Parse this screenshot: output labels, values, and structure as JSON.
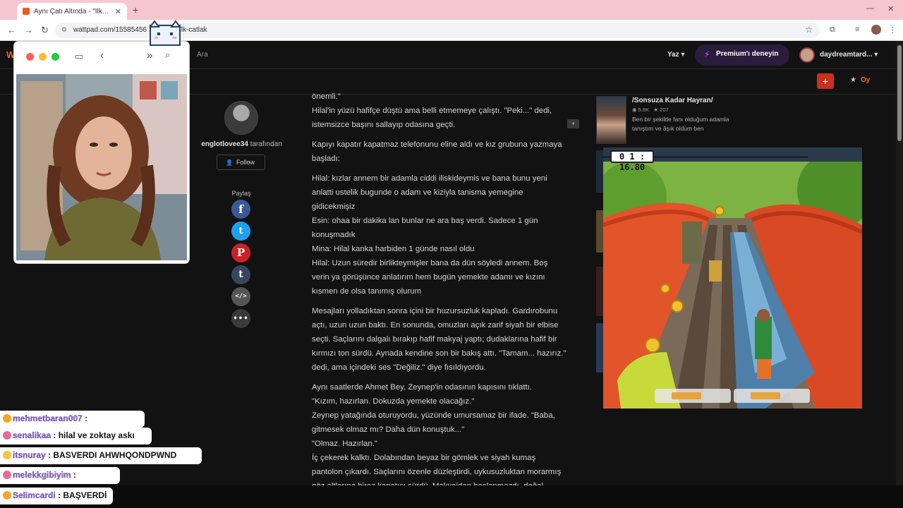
{
  "browser": {
    "tab_title": "Aynı Çatı Altında - \"İlk çatlak\"",
    "url": "wattpad.com/15585456 ... altinda-ilk-catlak"
  },
  "wattpad": {
    "search_label": "Ara",
    "write_label": "Yaz ▾",
    "premium_label": "Premium'ı deneyin",
    "username": "daydreamtard... ▾",
    "vote_label": "Oy",
    "author": {
      "name": "englotlovee34",
      "suffix": " tarafından",
      "follow_label": "Follow"
    },
    "share_label": "Paylaş",
    "story_paragraphs": [
      "önemli.\"\nHilal'in yüzü hafifçe düştü ama belli etmemeye çalıştı. \"Peki...\" dedi, istemsizce başını sallayıp odasına geçti.",
      "Kapıyı kapatır kapatmaz telefonunu eline aldı ve kız grubuna yazmaya başladı:",
      "Hilal: kızlar annem bir adamla ciddi iliskideymis ve bana bunu yeni anlatti ustelik bugunde o adam ve kiziyla tanisma yemegine gidicekmişiz\nEsin: ohaa bir dakika lan bunlar ne ara baş verdi. Sadece 1 gün konuşmadık\nMina: Hilal kanka harbiden 1 günde nasıl oldu\nHilal: Uzun süredir birlikteymişler bana da dün söyledi annem. Boş verin ya görüşünce anlatırım hem bugün yemekte adamı ve kızını kısmen de olsa tanımış olurum",
      "Mesajları yolladıktan sonra içini bir huzursuzluk kapladı. Gardırobunu açtı, uzun uzun baktı. En sonunda, omuzları açık zarif siyah bir elbise seçti. Saçlarını dalgalı bırakıp hafif makyaj yaptı; dudaklarına hafif bir kırmızı ton sürdü. Aynada kendine son bir bakış attı. \"Tamam... hazırız.\" dedi, ama içindeki ses \"Değiliz.\" diye fısıldıyordu.",
      "Aynı saatlerde Ahmet Bey, Zeynep'in odasının kapısını tıklattı.\n\"Kızım, hazırlan. Dokuzda yemekte olacağız.\"\nZeynep yatağında oturuyordu, yüzünde umursamaz bir ifade. \"Baba, gitmesek olmaz mı? Daha dün konuştuk...\"\n\"Olmaz. Hazırlan.\"\nİç çekerek kalktı. Dolabından beyaz bir gömlek ve siyah kumaş pantolon çıkardı. Saçlarını özenle düzleştirdi, uykusuzluktan morarmış göz altlarına biraz kapatıcı sürdü. Makyajdan hoşlanmazdı, doğal görünüm"
    ],
    "comment_count": "+",
    "recommendation": {
      "title": "/Sonsuza Kadar Hayran/",
      "views": "5.8K",
      "votes": "207",
      "description": "Ben bir şekilde fanı olduğum adamla tanıştım ve âşık oldum ben"
    }
  },
  "game": {
    "timer": "0 1 : 16.80"
  },
  "chat": [
    {
      "user": "mehmetbaran007",
      "message": " : "
    },
    {
      "user": "senalikaa",
      "message": " : hilal ve zoktay askı"
    },
    {
      "user": "itsnuray",
      "message": " : BASVERDI AHWHQONDPWND"
    },
    {
      "user": "melekkgibiyim",
      "message": " : "
    },
    {
      "user": "Selimcardi",
      "message": " : BAŞVERDİ"
    }
  ],
  "colors": {
    "accent": "#ff6122",
    "premium": "#d94ff5",
    "chat_user": "#8a63c7"
  }
}
